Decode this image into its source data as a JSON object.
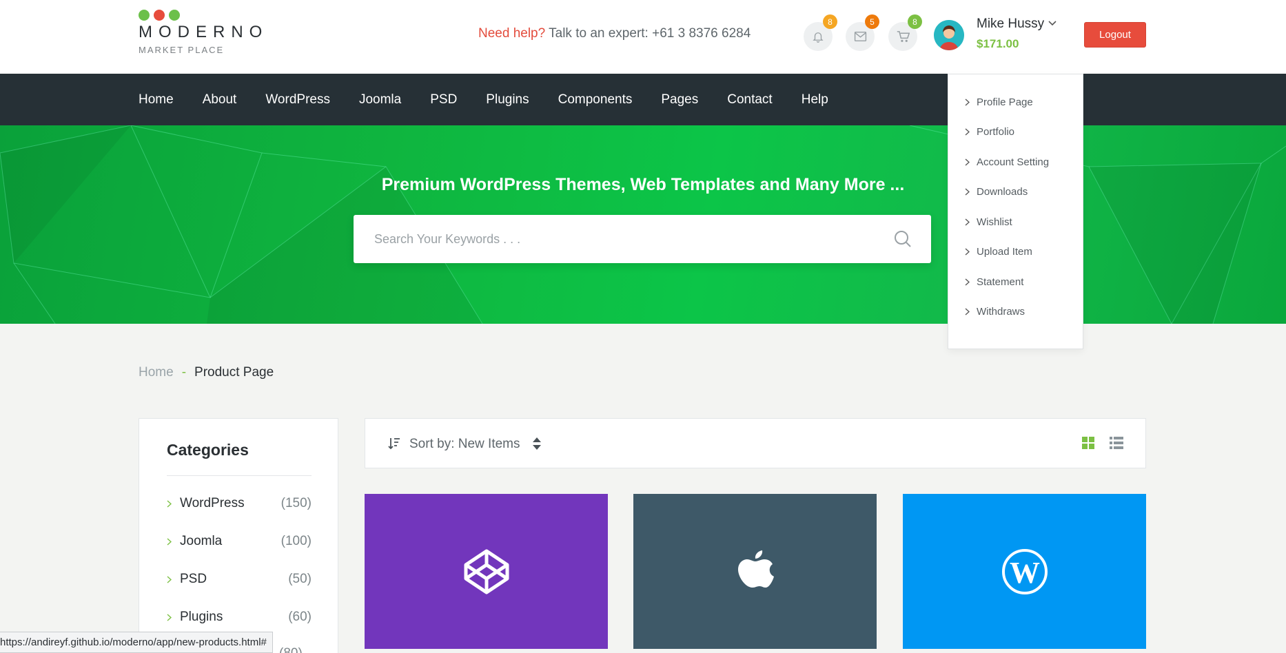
{
  "header": {
    "logo": {
      "brand": "MODERNO",
      "sub": "MARKET PLACE",
      "dot_colors": [
        "#6cc04a",
        "#e74c3c",
        "#6cc04a"
      ]
    },
    "help": {
      "prefix": "Need help?",
      "text": "Talk to an expert: +61 3 8376 6284"
    },
    "icons": [
      {
        "name": "bell-icon",
        "badge": "8",
        "badge_color": "#f5a623"
      },
      {
        "name": "envelope-icon",
        "badge": "5",
        "badge_color": "#ee7a0b"
      },
      {
        "name": "cart-icon",
        "badge": "8",
        "badge_color": "#7cc043"
      }
    ],
    "user": {
      "name": "Mike Hussy",
      "balance": "$171.00"
    },
    "logout_label": "Logout"
  },
  "nav": {
    "items": [
      "Home",
      "About",
      "WordPress",
      "Joomla",
      "PSD",
      "Plugins",
      "Components",
      "Pages",
      "Contact",
      "Help"
    ]
  },
  "hero": {
    "title": "Premium WordPress Themes, Web Templates and Many More ...",
    "search_placeholder": "Search Your Keywords . . ."
  },
  "user_menu": {
    "items": [
      "Profile Page",
      "Portfolio",
      "Account Setting",
      "Downloads",
      "Wishlist",
      "Upload Item",
      "Statement",
      "Withdraws"
    ]
  },
  "breadcrumb": {
    "home": "Home",
    "separator": "-",
    "current": "Product Page"
  },
  "sidebar": {
    "title": "Categories",
    "categories": [
      {
        "label": "WordPress",
        "count": "(150)"
      },
      {
        "label": "Joomla",
        "count": "(100)"
      },
      {
        "label": "PSD",
        "count": "(50)"
      },
      {
        "label": "Plugins",
        "count": "(60)"
      }
    ],
    "partial_count": "(80)"
  },
  "sortbar": {
    "label": "Sort by: New Items"
  },
  "products": [
    {
      "icon": "codepen-icon",
      "bg": "#7236bc"
    },
    {
      "icon": "apple-icon",
      "bg": "#3e5968"
    },
    {
      "icon": "wordpress-icon",
      "bg": "#0097f3"
    }
  ],
  "statusbar": {
    "url": "https://andireyf.github.io/moderno/app/new-products.html#"
  },
  "colors": {
    "accent_green": "#7cc043",
    "nav_bg": "#263036",
    "logout_red": "#e74c3c"
  }
}
